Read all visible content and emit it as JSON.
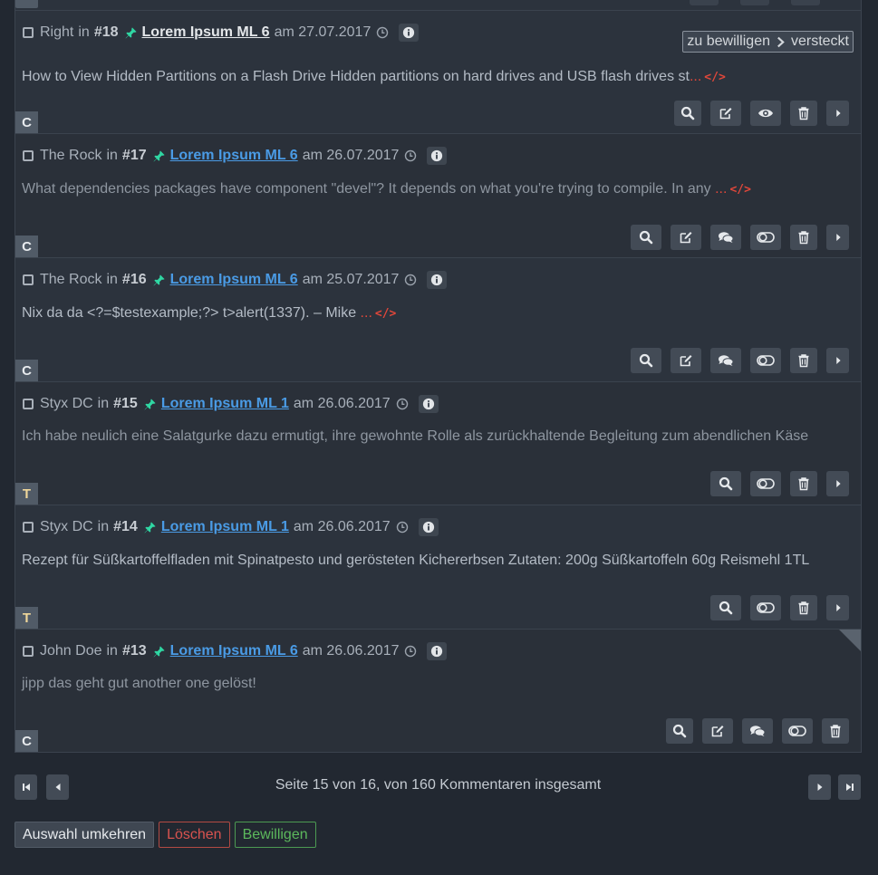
{
  "comments": [
    {
      "author": "Right",
      "in": "in",
      "number": "#18",
      "topic": "Lorem Ipsum ML 6",
      "am": "am",
      "date": "27.07.2017",
      "text": "How to View Hidden Partitions on a Flash Drive Hidden partitions on hard drives and USB flash drives st",
      "ellipsis": "...",
      "code": "</>",
      "badge": "C",
      "status_from": "zu bewilligen",
      "status_to": "versteckt",
      "actions": [
        "search-icon",
        "edit-icon",
        "eye-icon",
        "trash-icon",
        "caret-right-icon"
      ]
    },
    {
      "author": "The Rock",
      "in": "in",
      "number": "#17",
      "topic": "Lorem Ipsum ML 6",
      "am": "am",
      "date": "26.07.2017",
      "text": "What dependencies packages have component \"devel\"? It depends on what you're trying to compile. In any ",
      "ellipsis": "...",
      "code": "</>",
      "badge": "C",
      "actions": [
        "search-icon",
        "edit-icon",
        "comments-icon",
        "toggle-icon",
        "trash-icon",
        "caret-right-icon"
      ]
    },
    {
      "author": "The Rock",
      "in": "in",
      "number": "#16",
      "topic": "Lorem Ipsum ML 6",
      "am": "am",
      "date": "25.07.2017",
      "text": "Nix da da <?=$testexample;?> t>alert(1337). – Mike ",
      "ellipsis": "...",
      "code": "</>",
      "badge": "C",
      "actions": [
        "search-icon",
        "edit-icon",
        "comments-icon",
        "toggle-icon",
        "trash-icon",
        "caret-right-icon"
      ]
    },
    {
      "author": "Styx DC",
      "in": "in",
      "number": "#15",
      "topic": "Lorem Ipsum ML 1",
      "am": "am",
      "date": "26.06.2017",
      "text": "Ich habe neulich eine Salatgurke dazu ermutigt, ihre gewohnte Rolle als zurückhaltende Begleitung zum abendlichen Käse",
      "badge": "T",
      "actions": [
        "search-icon",
        "toggle-icon",
        "trash-icon",
        "caret-right-icon"
      ]
    },
    {
      "author": "Styx DC",
      "in": "in",
      "number": "#14",
      "topic": "Lorem Ipsum ML 1",
      "am": "am",
      "date": "26.06.2017",
      "text": "Rezept für Süßkartoffelfladen mit Spinatpesto und gerösteten Kichererbsen Zutaten: 200g Süßkartoffeln 60g Reismehl 1TL",
      "badge": "T",
      "actions": [
        "search-icon",
        "toggle-icon",
        "trash-icon",
        "caret-right-icon"
      ]
    },
    {
      "author": "John Doe",
      "in": "in",
      "number": "#13",
      "topic": "Lorem Ipsum ML 6",
      "am": "am",
      "date": "26.06.2017",
      "text": "jipp das geht gut another one gelöst!",
      "badge": "C",
      "actions": [
        "search-icon",
        "edit-icon",
        "comments-icon",
        "toggle-icon",
        "trash-icon"
      ]
    }
  ],
  "pagination": {
    "info": "Seite 15 von 16, von 160 Kommentaren insgesamt",
    "icons": [
      "first-page-icon",
      "prev-page-icon",
      "next-page-icon",
      "last-page-icon"
    ]
  },
  "buttons": {
    "invert": "Auswahl umkehren",
    "delete": "Löschen",
    "approve": "Bewilligen"
  },
  "colors": {
    "background": "#222831",
    "panel": "#2c333d",
    "link": "#4a9be5",
    "pin": "#2fd7a3",
    "code": "#e0473a",
    "delete": "#d9534f",
    "approve": "#5cb85c"
  }
}
